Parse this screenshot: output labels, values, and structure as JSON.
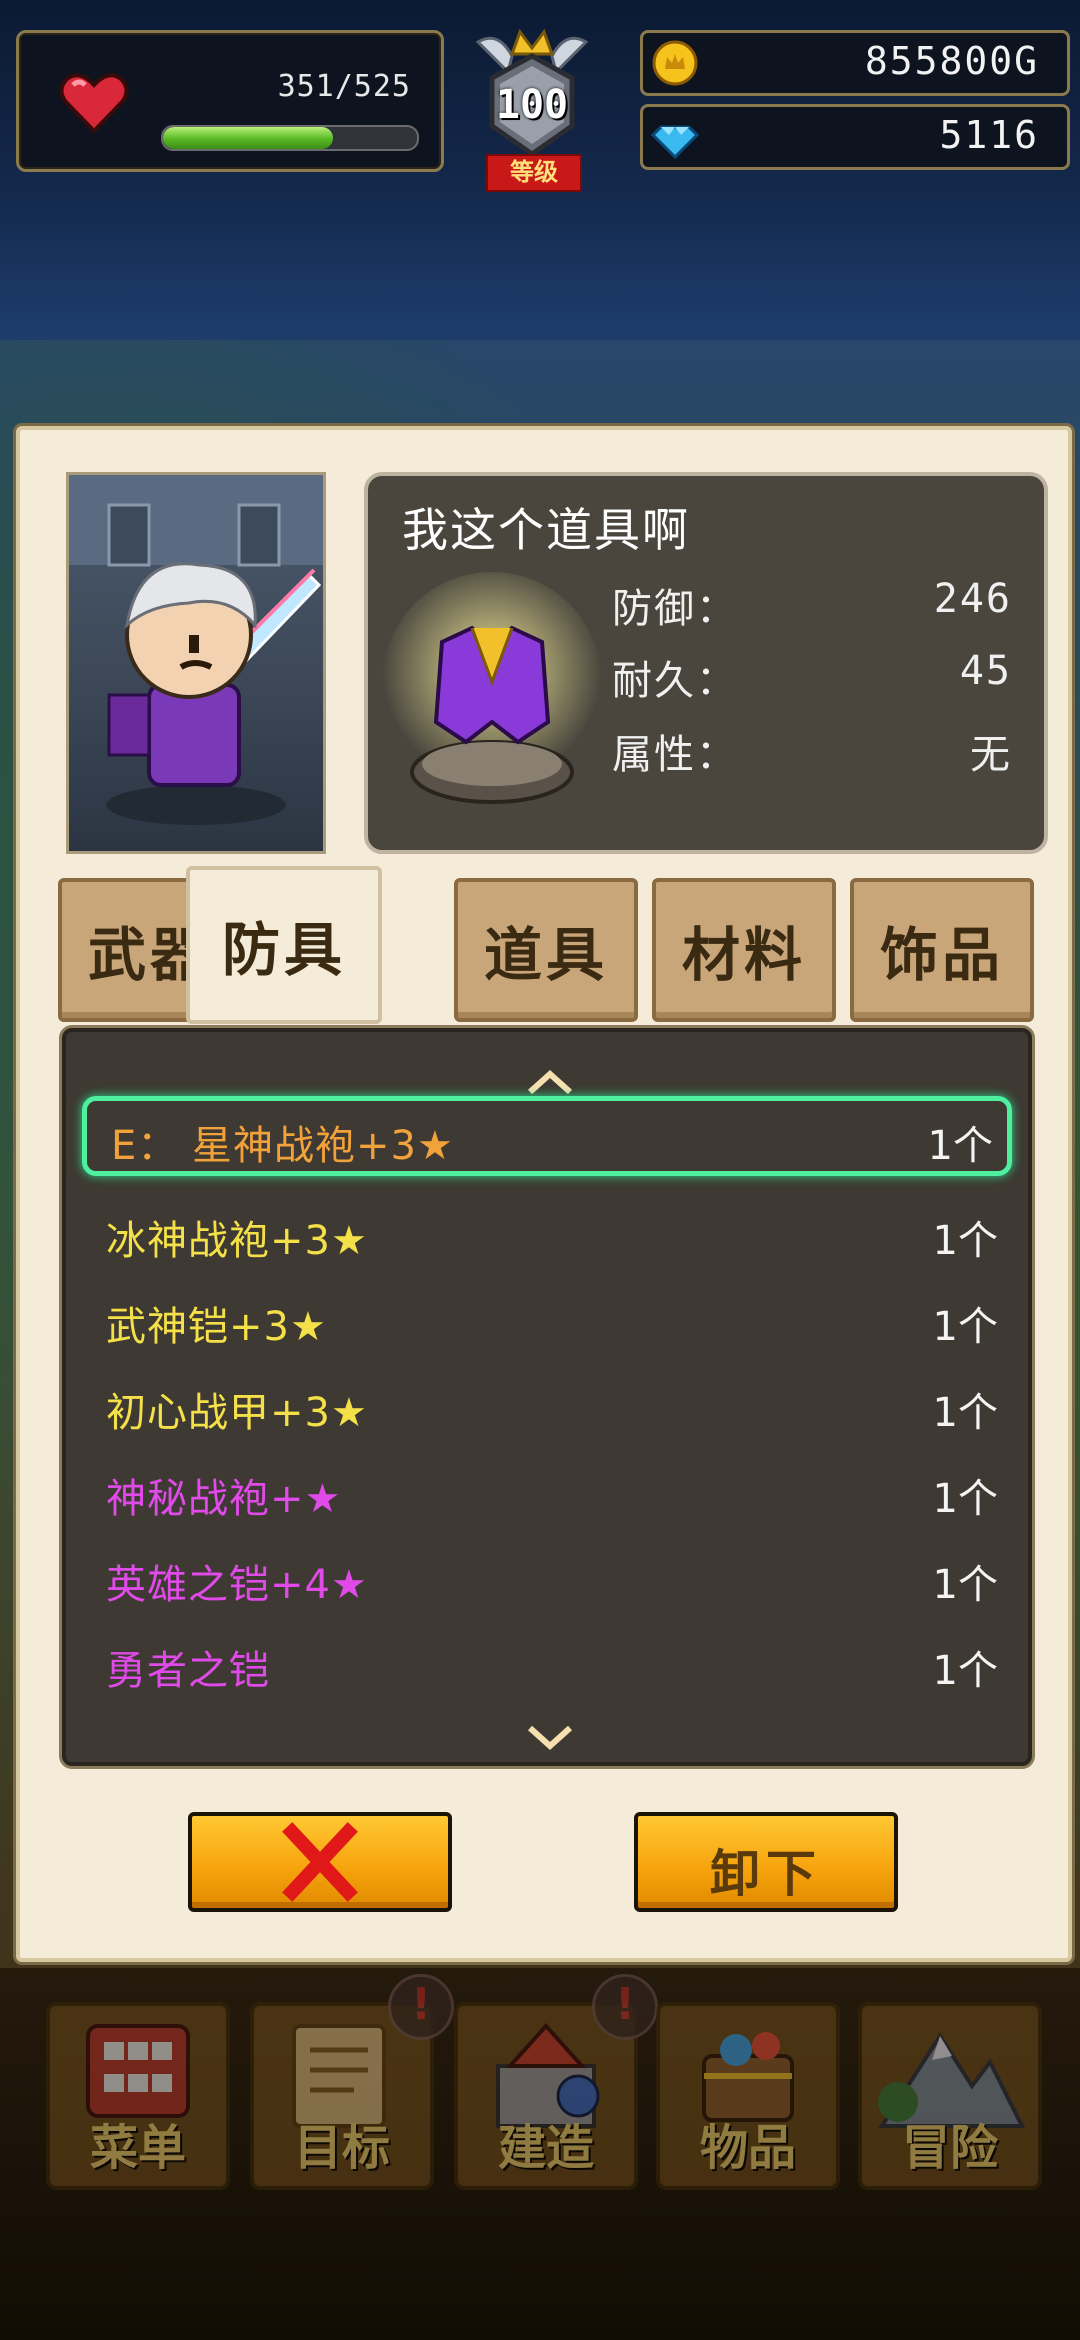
{
  "hud": {
    "hp_text": "351/525",
    "hp_fraction": 0.67,
    "level": "100",
    "level_label": "等级",
    "gold": "855800G",
    "gems": "5116"
  },
  "item": {
    "title": "我这个道具啊",
    "stats": [
      {
        "label": "防御：",
        "value": "246"
      },
      {
        "label": "耐久：",
        "value": "45"
      },
      {
        "label": "属性：",
        "value": "无"
      }
    ]
  },
  "tabs": [
    "武器",
    "防具",
    "道具",
    "材料",
    "饰品"
  ],
  "active_tab": 1,
  "inventory": [
    {
      "name": "E：  星神战袍+3★",
      "count": "1个",
      "color": "#f2a23a",
      "selected": true
    },
    {
      "name": "冰神战袍+3★",
      "count": "1个",
      "color": "#f4e048"
    },
    {
      "name": "武神铠+3★",
      "count": "1个",
      "color": "#f4e048"
    },
    {
      "name": "初心战甲+3★",
      "count": "1个",
      "color": "#f4e048"
    },
    {
      "name": "神秘战袍+★",
      "count": "1个",
      "color": "#e04ae8"
    },
    {
      "name": "英雄之铠+4★",
      "count": "1个",
      "color": "#e04ae8"
    },
    {
      "name": "勇者之铠",
      "count": "1个",
      "color": "#e04ae8"
    }
  ],
  "buttons": {
    "close_icon": "red-x-icon",
    "unequip": "卸下"
  },
  "menu": [
    {
      "label": "菜单",
      "icon": "grid-icon",
      "alert": false
    },
    {
      "label": "目标",
      "icon": "quest-scroll-icon",
      "alert": true
    },
    {
      "label": "建造",
      "icon": "castle-icon",
      "alert": true
    },
    {
      "label": "物品",
      "icon": "treasure-chest-icon",
      "alert": false
    },
    {
      "label": "冒险",
      "icon": "mountain-icon",
      "alert": false
    }
  ],
  "colors": {
    "selection_outline": "#4ef0a0",
    "button_orange": "#f6a20c",
    "panel_cream": "#f4ecd8",
    "tab_tan": "#c8a67a"
  }
}
